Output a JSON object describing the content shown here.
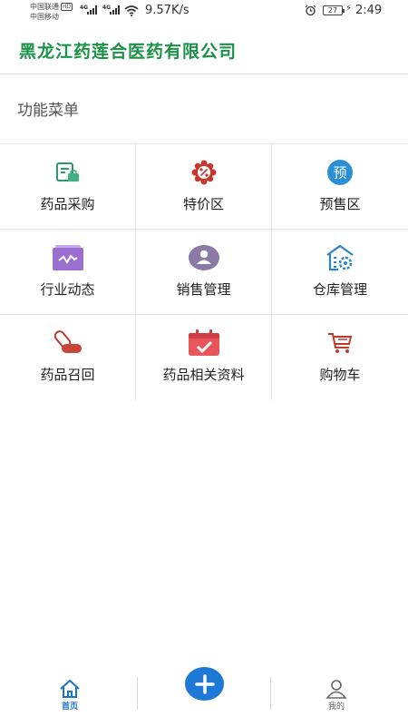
{
  "status_bar": {
    "carrier_1": "中国联通",
    "carrier_1_badge": "HD",
    "carrier_2": "中国移动",
    "signal_1_type": "4G",
    "signal_2_type": "4G",
    "net_speed": "9.57K/s",
    "battery_level": "27",
    "time": "2:49"
  },
  "header": {
    "title": "黑龙江药莲合医药有限公司"
  },
  "section": {
    "title": "功能菜单"
  },
  "menu": {
    "items": [
      {
        "label": "药品采购",
        "icon": "purchase-icon"
      },
      {
        "label": "特价区",
        "icon": "discount-icon"
      },
      {
        "label": "预售区",
        "icon": "presale-icon",
        "icon_text": "预"
      },
      {
        "label": "行业动态",
        "icon": "news-icon"
      },
      {
        "label": "销售管理",
        "icon": "sales-user-icon"
      },
      {
        "label": "仓库管理",
        "icon": "warehouse-icon"
      },
      {
        "label": "药品召回",
        "icon": "pill-icon"
      },
      {
        "label": "药品相关资料",
        "icon": "calendar-check-icon"
      },
      {
        "label": "购物车",
        "icon": "cart-icon"
      }
    ]
  },
  "tabbar": {
    "home_label": "首页",
    "add_icon": "plus-icon",
    "me_label": "我的"
  },
  "colors": {
    "brand_green": "#1c9249",
    "primary_blue": "#1d78d6",
    "presale_blue": "#2a8fd4",
    "discount_red": "#c8372d",
    "news_purple": "#9b6fcf",
    "sales_purple": "#8a7aa6",
    "docs_red": "#e8555a"
  }
}
